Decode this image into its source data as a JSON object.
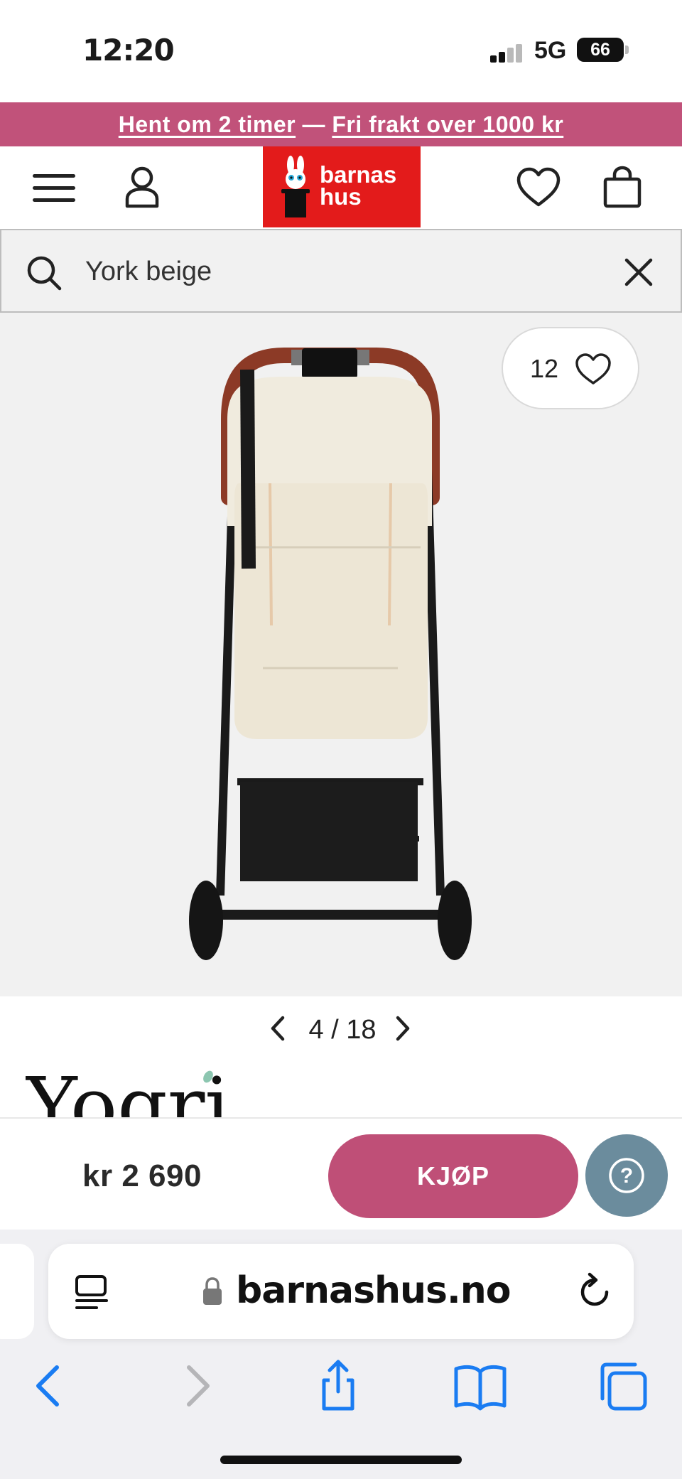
{
  "status_bar": {
    "time": "12:20",
    "network": "5G",
    "battery": "66"
  },
  "promo": {
    "link_pickup": "Hent om 2 timer",
    "separator": " — ",
    "link_shipping": "Fri frakt over 1000 kr"
  },
  "header": {
    "logo_line1": "barnas",
    "logo_line2": "hus"
  },
  "search": {
    "value": "York beige"
  },
  "product": {
    "favorite_count": "12",
    "pager": {
      "current": "4",
      "separator": " / ",
      "total": "18"
    },
    "brand_logo_text": "Yogri",
    "price": "kr 2 690",
    "buy_label": "KJØP",
    "help_label": "?"
  },
  "browser": {
    "url": "barnashus.no"
  },
  "colors": {
    "promo": "#c1527a",
    "buy_button": "#bf4f77",
    "help_button": "#6b8c9d",
    "logo_bg": "#e31b1b",
    "safari_accent": "#1a7cf2"
  },
  "icons": [
    "menu-icon",
    "user-icon",
    "heart-icon",
    "shopping-bag-icon",
    "search-icon",
    "close-icon",
    "chevron-left-icon",
    "chevron-right-icon",
    "question-icon",
    "reader-icon",
    "lock-icon",
    "reload-icon",
    "back-icon",
    "forward-icon",
    "share-icon",
    "bookmarks-icon",
    "tabs-icon"
  ]
}
